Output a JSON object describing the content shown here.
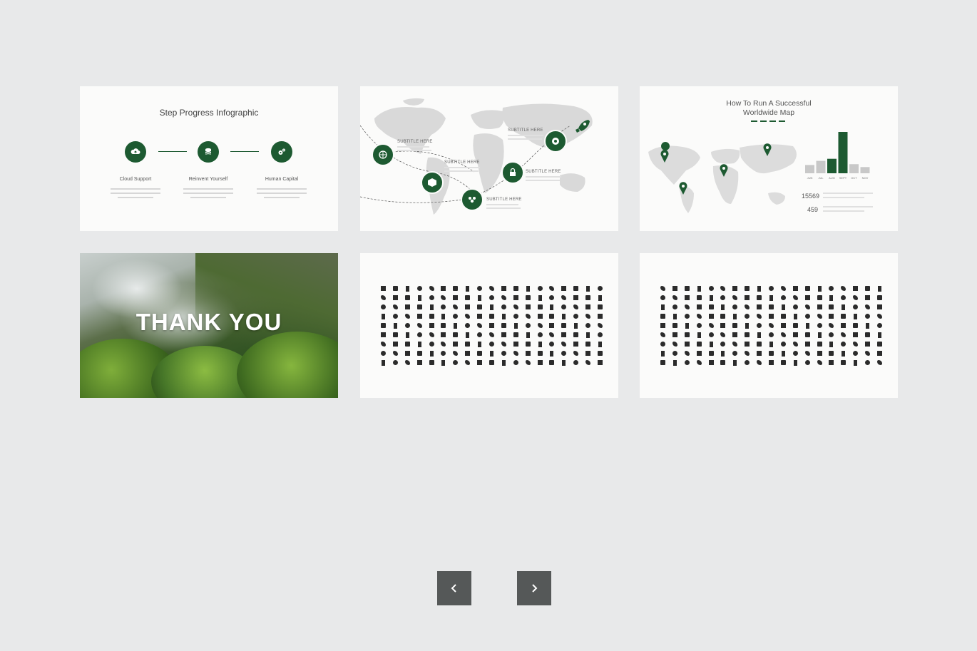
{
  "slides": {
    "step_progress": {
      "title": "Step Progress Infographic",
      "steps": [
        {
          "label": "Cloud Support",
          "icon": "cloud-upload-icon"
        },
        {
          "label": "Reinvent Yourself",
          "icon": "database-icon"
        },
        {
          "label": "Human Capital",
          "icon": "gears-icon"
        }
      ]
    },
    "world_map_subtitles": {
      "subtitles": [
        "SUBTITLE HERE",
        "SUBTITLE HERE",
        "SUBTITLE HERE",
        "SUBTITLE HERE",
        "SUBTITLE HERE"
      ],
      "icons": [
        "rocket-icon",
        "globe-icon",
        "map-pin-icon",
        "box-icon",
        "lock-icon",
        "users-icon"
      ]
    },
    "worldwide_map": {
      "title_line1": "How To Run A Successful",
      "title_line2": "Worldwide Map",
      "stats": [
        "15569",
        "459"
      ],
      "bar_chart": {
        "categories": [
          "JUN",
          "JUL",
          "AUG",
          "SEPT",
          "OCT",
          "NOV"
        ],
        "values": [
          20,
          30,
          35,
          100,
          22,
          15
        ],
        "highlight_color": "#1d5a31",
        "base_color": "#c8c8c8"
      }
    },
    "thank_you": {
      "text": "THANK YOU"
    },
    "icon_set_a": {
      "label": "icon set"
    },
    "icon_set_b": {
      "label": "icon set"
    }
  },
  "navigation": {
    "prev_icon": "chevron-left-icon",
    "next_icon": "chevron-right-icon"
  },
  "colors": {
    "accent": "#1d5a31",
    "background": "#e8e9ea",
    "card": "#fbfbfa",
    "nav_button": "#555858"
  }
}
